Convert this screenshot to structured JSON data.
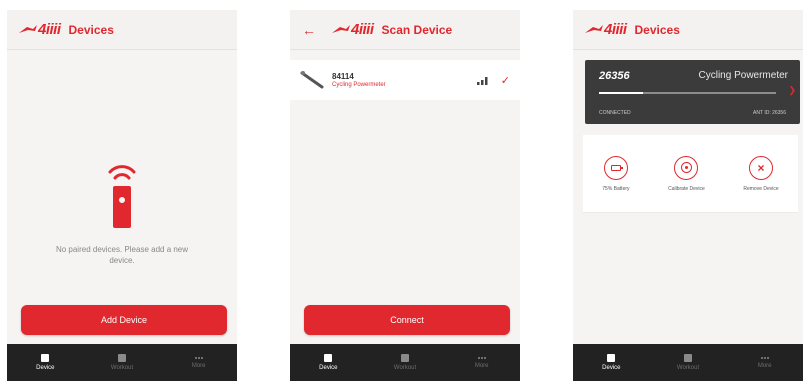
{
  "brand": {
    "logo_text": "4iiii",
    "accent": "#e0282e"
  },
  "nav": [
    {
      "label": "Device",
      "active": true
    },
    {
      "label": "Workout",
      "active": false
    },
    {
      "label": "More",
      "active": false
    }
  ],
  "screen1": {
    "title": "Devices",
    "empty_text": "No paired devices. Please add a new device.",
    "add_button": "Add Device"
  },
  "screen2": {
    "title": "Scan Device",
    "scan_item": {
      "id": "84114",
      "type": "Cycling Powermeter"
    },
    "connect_button": "Connect"
  },
  "screen3": {
    "title": "Devices",
    "card": {
      "id": "26356",
      "type": "Cycling Powermeter",
      "status": "CONNECTED",
      "ant_id": "ANT ID: 26356",
      "progress": 0.25
    },
    "actions": [
      {
        "label": "75% Battery",
        "icon": "battery-icon"
      },
      {
        "label": "Calibrate Device",
        "icon": "calibrate-icon"
      },
      {
        "label": "Remove Device",
        "icon": "remove-icon"
      }
    ]
  }
}
